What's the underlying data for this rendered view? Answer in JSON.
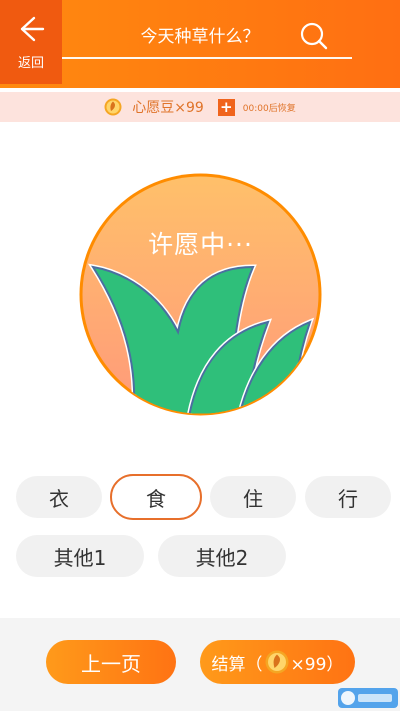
{
  "header": {
    "back_label": "返回",
    "title": "今天种草什么？"
  },
  "beans": {
    "text": "心愿豆×99",
    "plus": "+",
    "recover": "00:00后恢复"
  },
  "wish": {
    "status": "许愿中···"
  },
  "categories": [
    {
      "label": "衣",
      "selected": false
    },
    {
      "label": "食",
      "selected": true
    },
    {
      "label": "住",
      "selected": false
    },
    {
      "label": "行",
      "selected": false
    },
    {
      "label": "其他1",
      "selected": false
    },
    {
      "label": "其他2",
      "selected": false
    }
  ],
  "footer": {
    "prev_label": "上一页",
    "checkout_prefix": "结算（",
    "checkout_suffix": "×99）"
  },
  "colors": {
    "accent": "#ff7a12",
    "selected_border": "#e76f2b",
    "grass": "#2fbf7a"
  }
}
